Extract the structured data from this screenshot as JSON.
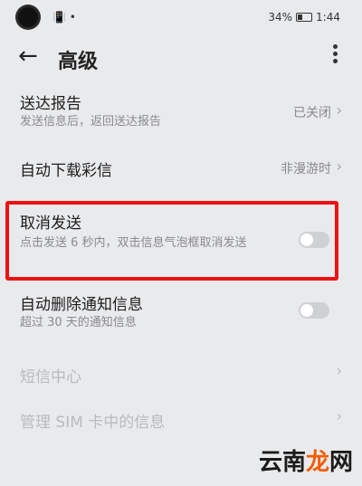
{
  "status": {
    "left_indicators": "📳 •",
    "battery": "34%",
    "time": "1:44"
  },
  "header": {
    "title": "高级"
  },
  "settings": [
    {
      "title": "送达报告",
      "subtitle": "发送信息后，返回送达报告",
      "value": "已关闭"
    },
    {
      "title": "自动下载彩信",
      "value": "非漫游时"
    },
    {
      "title": "取消发送",
      "subtitle": "点击发送 6 秒内，双击信息气泡框取消发送",
      "toggle_on": false
    },
    {
      "title": "自动删除通知信息",
      "subtitle": "超过 30 天的通知信息",
      "toggle_on": false
    },
    {
      "title": "短信中心"
    },
    {
      "title": "管理 SIM 卡中的信息"
    }
  ],
  "watermark": {
    "text_main": "云南",
    "text_accent": "龙",
    "text_tail": "网"
  }
}
